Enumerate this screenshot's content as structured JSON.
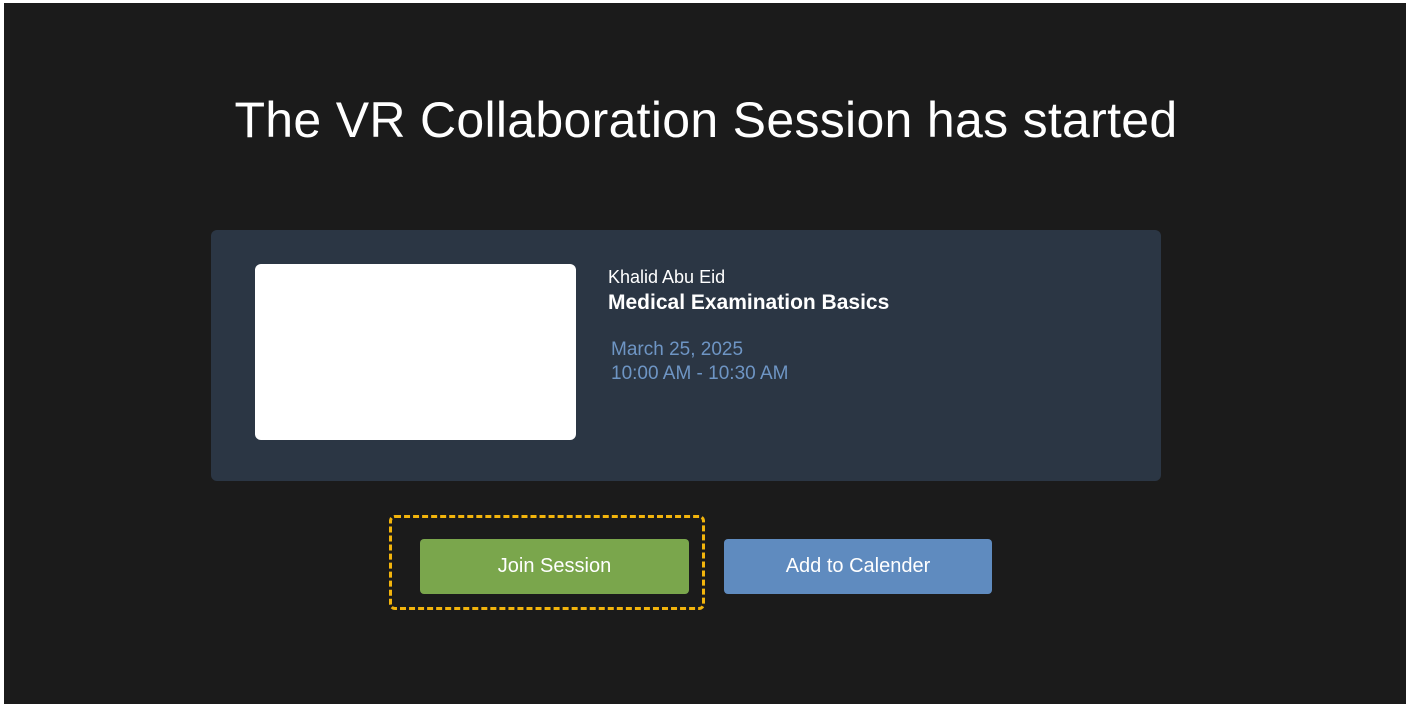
{
  "page": {
    "title": "The VR Collaboration Session has started"
  },
  "session_card": {
    "host": "Khalid Abu Eid",
    "course": "Medical Examination Basics",
    "date": "March 25, 2025",
    "time": "10:00 AM - 10:30 AM"
  },
  "actions": {
    "join_label": "Join Session",
    "calendar_label": "Add to Calender"
  },
  "colors": {
    "background": "#1b1b1b",
    "card": "#2b3644",
    "join_button": "#7aa64c",
    "calendar_button": "#5f8bbf",
    "focus_ring": "#f2b40c",
    "date_text": "#6e95c4"
  }
}
